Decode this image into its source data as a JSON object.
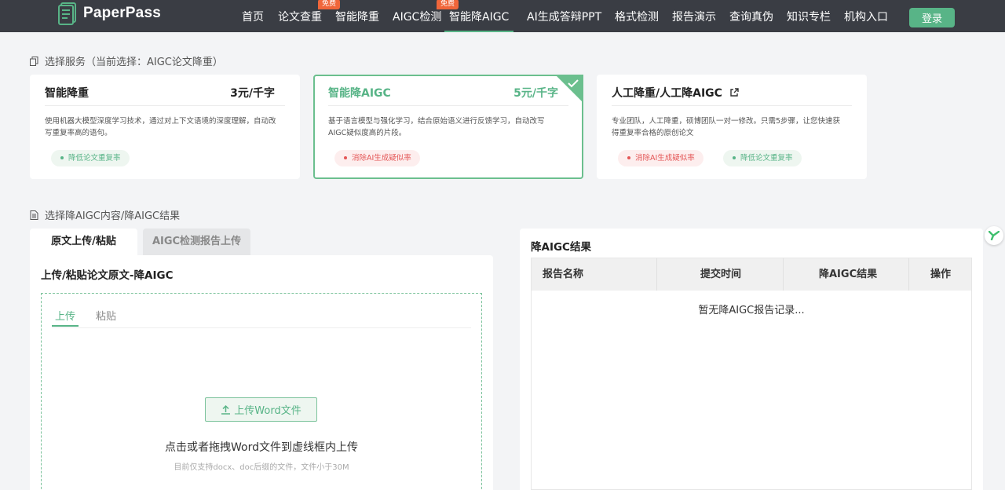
{
  "header": {
    "brand": "PaperPass",
    "nav": [
      {
        "label": "首页",
        "badge": ""
      },
      {
        "label": "论文查重",
        "badge": "免费"
      },
      {
        "label": "智能降重",
        "badge": ""
      },
      {
        "label": "AIGC检测",
        "badge": "免费"
      },
      {
        "label": "智能降AIGC",
        "badge": "",
        "active": true
      },
      {
        "label": "AI生成答辩PPT",
        "badge": ""
      },
      {
        "label": "格式检测",
        "badge": ""
      },
      {
        "label": "报告演示",
        "badge": ""
      },
      {
        "label": "查询真伪",
        "badge": ""
      },
      {
        "label": "知识专栏",
        "badge": ""
      },
      {
        "label": "机构入口",
        "badge": ""
      }
    ],
    "login": "登录"
  },
  "service_section": {
    "title": "选择服务（当前选择：AIGC论文降重）"
  },
  "cards": [
    {
      "title": "智能降重",
      "price": "3元/千字",
      "desc": "使用机器大模型深度学习技术，通过对上下文语境的深度理解，自动改写重复率高的语句。",
      "tags": [
        {
          "label": "降低论文重复率",
          "tone": "green"
        }
      ]
    },
    {
      "title": "智能降AIGC",
      "price": "5元/千字",
      "desc": "基于语言模型与强化学习，结合原始语义进行反馈学习，自动改写AIGC疑似度高的片段。",
      "tags": [
        {
          "label": "消除AI生成疑似率",
          "tone": "red"
        }
      ],
      "selected": true
    },
    {
      "title": "人工降重/人工降AIGC",
      "price": "",
      "desc": "专业团队，人工降重，硕博团队一对一修改。只需5步骤，让您快速获得重复率合格的原创论文",
      "tags": [
        {
          "label": "消除AI生成疑似率",
          "tone": "red"
        },
        {
          "label": "降低论文重复率",
          "tone": "green"
        }
      ]
    }
  ],
  "content_section": {
    "title": "选择降AIGC内容/降AIGC结果"
  },
  "left_panel": {
    "tabs": [
      "原文上传/粘贴",
      "AIGC检测报告上传"
    ],
    "heading": "上传/粘贴论文原文-降AIGC",
    "subtabs": [
      "上传",
      "粘贴"
    ],
    "upload_button": "上传Word文件",
    "drop_hint": "点击或者拖拽Word文件到虚线框内上传",
    "drop_sub": "目前仅支持docx、doc后缀的文件，文件小于30M"
  },
  "right_panel": {
    "title": "降AIGC结果",
    "columns": [
      "报告名称",
      "提交时间",
      "降AIGC结果",
      "操作"
    ],
    "empty": "暂无降AIGC报告记录..."
  },
  "colors": {
    "accent": "#58b487",
    "header_bg": "#3a3d44",
    "badge": "#f0663a",
    "danger": "#e45656"
  },
  "icons": [
    "paperpass-logo-icon",
    "copy-icon",
    "document-icon",
    "external-link-icon",
    "check-icon",
    "upload-icon",
    "feedback-icon"
  ]
}
